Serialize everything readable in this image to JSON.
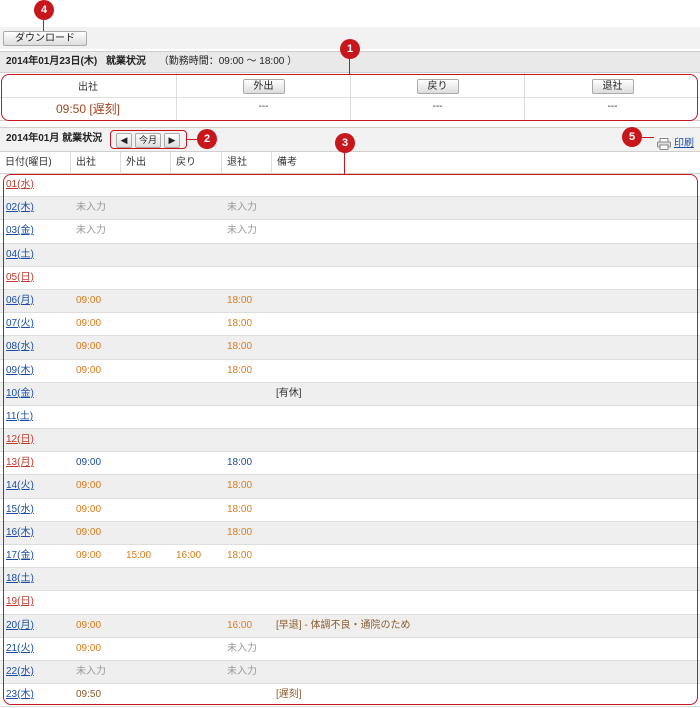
{
  "toolbar": {
    "download_label": "ダウンロード"
  },
  "markers": {
    "m1": "1",
    "m2": "2",
    "m3": "3",
    "m4": "4",
    "m5": "5"
  },
  "today": {
    "date_title": "2014年01月23日(木)",
    "status_title": "就業状況",
    "work_hours": "（勤務時間：09:00 〜 18:00 ）",
    "clock_in_label": "出社",
    "clock_in_value": "09:50 [遅刻]",
    "out_button": "外出",
    "out_value": "---",
    "return_button": "戻り",
    "return_value": "---",
    "leave_button": "退社",
    "leave_value": "---"
  },
  "monthly": {
    "title": "2014年01月 就業状況",
    "prev_label": "◀",
    "current_label": "今月",
    "next_label": "▶",
    "print_label": "印刷",
    "columns": [
      "日付(曜日)",
      "出社",
      "外出",
      "戻り",
      "退社",
      "備考"
    ],
    "rows": [
      {
        "date": "01(水)",
        "in": "",
        "out": "",
        "back": "",
        "leave": "",
        "note": "",
        "day": "we",
        "st": ""
      },
      {
        "date": "02(木)",
        "in": "未入力",
        "out": "",
        "back": "",
        "leave": "未入力",
        "note": "",
        "day": "wd",
        "st": "gray"
      },
      {
        "date": "03(金)",
        "in": "未入力",
        "out": "",
        "back": "",
        "leave": "未入力",
        "note": "",
        "day": "wd",
        "st": "gray"
      },
      {
        "date": "04(土)",
        "in": "",
        "out": "",
        "back": "",
        "leave": "",
        "note": "",
        "day": "wd",
        "st": ""
      },
      {
        "date": "05(日)",
        "in": "",
        "out": "",
        "back": "",
        "leave": "",
        "note": "",
        "day": "we",
        "st": ""
      },
      {
        "date": "06(月)",
        "in": "09:00",
        "out": "",
        "back": "",
        "leave": "18:00",
        "note": "",
        "day": "wd",
        "st": "orange"
      },
      {
        "date": "07(火)",
        "in": "09:00",
        "out": "",
        "back": "",
        "leave": "18:00",
        "note": "",
        "day": "wd",
        "st": "orange"
      },
      {
        "date": "08(水)",
        "in": "09:00",
        "out": "",
        "back": "",
        "leave": "18:00",
        "note": "",
        "day": "wd",
        "st": "orange"
      },
      {
        "date": "09(木)",
        "in": "09:00",
        "out": "",
        "back": "",
        "leave": "18:00",
        "note": "",
        "day": "wd",
        "st": "orange"
      },
      {
        "date": "10(金)",
        "in": "",
        "out": "",
        "back": "",
        "leave": "",
        "note": "[有休]",
        "day": "wd",
        "st": "dark"
      },
      {
        "date": "11(土)",
        "in": "",
        "out": "",
        "back": "",
        "leave": "",
        "note": "",
        "day": "wd",
        "st": ""
      },
      {
        "date": "12(日)",
        "in": "",
        "out": "",
        "back": "",
        "leave": "",
        "note": "",
        "day": "we",
        "st": ""
      },
      {
        "date": "13(月)",
        "in": "09:00",
        "out": "",
        "back": "",
        "leave": "18:00",
        "note": "",
        "day": "we",
        "st": "blue"
      },
      {
        "date": "14(火)",
        "in": "09:00",
        "out": "",
        "back": "",
        "leave": "18:00",
        "note": "",
        "day": "wd",
        "st": "orange"
      },
      {
        "date": "15(水)",
        "in": "09:00",
        "out": "",
        "back": "",
        "leave": "18:00",
        "note": "",
        "day": "wd",
        "st": "orange"
      },
      {
        "date": "16(木)",
        "in": "09:00",
        "out": "",
        "back": "",
        "leave": "18:00",
        "note": "",
        "day": "wd",
        "st": "orange"
      },
      {
        "date": "17(金)",
        "in": "09:00",
        "out": "15:00",
        "back": "16:00",
        "leave": "18:00",
        "note": "",
        "day": "wd",
        "st": "orange"
      },
      {
        "date": "18(土)",
        "in": "",
        "out": "",
        "back": "",
        "leave": "",
        "note": "",
        "day": "wd",
        "st": ""
      },
      {
        "date": "19(日)",
        "in": "",
        "out": "",
        "back": "",
        "leave": "",
        "note": "",
        "day": "we",
        "st": ""
      },
      {
        "date": "20(月)",
        "in": "09:00",
        "out": "",
        "back": "",
        "leave": "16:00",
        "note": "[早退] - 体調不良・通院のため",
        "day": "wd",
        "st": "orange"
      },
      {
        "date": "21(火)",
        "in": "09:00",
        "out": "",
        "back": "",
        "leave": "未入力",
        "note": "",
        "day": "wd",
        "st": "orange"
      },
      {
        "date": "22(水)",
        "in": "未入力",
        "out": "",
        "back": "",
        "leave": "未入力",
        "note": "",
        "day": "wd",
        "st": "gray"
      },
      {
        "date": "23(木)",
        "in": "09:50",
        "out": "",
        "back": "",
        "leave": "",
        "note": "[遅刻]",
        "day": "wd",
        "st": "late"
      }
    ]
  },
  "colors": {
    "accent_red": "#c8161d",
    "weekday_link": "#1a4ea6",
    "weekend_link": "#c0392b",
    "time_orange": "#e07a18",
    "pending_gray": "#999999"
  }
}
